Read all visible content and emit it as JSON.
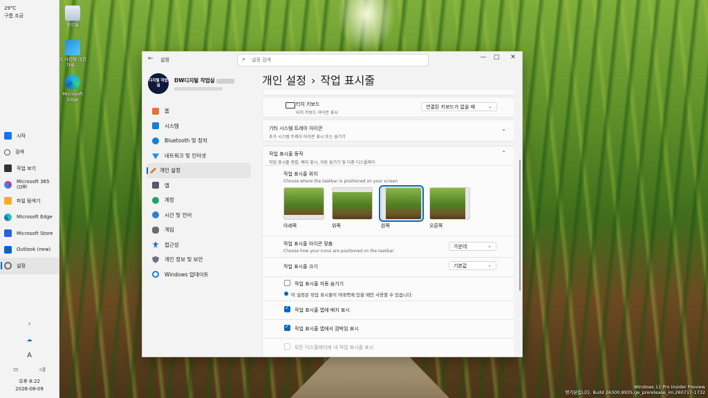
{
  "weather": {
    "temp": "29°C",
    "cond": "구름 조금"
  },
  "desktop_icons": [
    {
      "label": "휴지통"
    },
    {
      "label": "이 사진에 대한 자세..."
    },
    {
      "label": "Microsoft Edge"
    }
  ],
  "taskbar": {
    "items": [
      {
        "label": "시작",
        "color": "#1a73e8"
      },
      {
        "label": "검색",
        "color": "#444444"
      },
      {
        "label": "작업 보기",
        "color": "#333333"
      },
      {
        "label": "Microsoft 365 (Offi",
        "color": "#d03c8c"
      },
      {
        "label": "파일 탐색기",
        "color": "#f2b01e"
      },
      {
        "label": "Microsoft Edge",
        "color": "#0f9bd7"
      },
      {
        "label": "Microsoft Store",
        "color": "#2b62d9"
      },
      {
        "label": "Outlook (new)",
        "color": "#0a64c8"
      },
      {
        "label": "설정",
        "color": "#6b6b6b"
      }
    ],
    "time": "오후 8:22",
    "date": "2026-08-09"
  },
  "window": {
    "app_title": "설정",
    "search_placeholder": "설정 검색",
    "profile": {
      "avatar_text": "디지털 작업실",
      "name": "DW디지털 작업실"
    },
    "nav": [
      {
        "label": "홈",
        "color": "#e5733a"
      },
      {
        "label": "시스템",
        "color": "#1a7fd4"
      },
      {
        "label": "Bluetooth 및 장치",
        "color": "#1a7fd4"
      },
      {
        "label": "네트워크 및 인터넷",
        "color": "#2b8ae0"
      },
      {
        "label": "개인 설정",
        "color": "#d9822b"
      },
      {
        "label": "앱",
        "color": "#555b6e"
      },
      {
        "label": "계정",
        "color": "#21a06a"
      },
      {
        "label": "시간 및 언어",
        "color": "#2f7fd0"
      },
      {
        "label": "게임",
        "color": "#6b6b6b"
      },
      {
        "label": "접근성",
        "color": "#1f6fc4"
      },
      {
        "label": "개인 정보 및 보안",
        "color": "#6b7280"
      },
      {
        "label": "Windows 업데이트",
        "color": "#1a7fd4"
      }
    ],
    "heading_parent": "개인 설정",
    "heading_sep": "›",
    "heading_current": "작업 표시줄",
    "touch_keyboard": {
      "title": "터치 키보드",
      "sub": "터치 키보드 아이콘 표시",
      "value": "연결된 키보드가 없을 때"
    },
    "tray": {
      "title": "기타 시스템 트레이 아이콘",
      "sub": "추가 시스템 트레이 아이콘 표시 또는 숨기기"
    },
    "behaviors": {
      "title": "작업 표시줄 동작",
      "sub": "작업 표시줄 정렬, 배지 표시, 자동 숨기기 및 다중 디스플레이",
      "position_title": "작업 표시줄 위치",
      "position_sub": "Choose where the taskbar is positioned on your screen",
      "positions": [
        "아래쪽",
        "위쪽",
        "왼쪽",
        "오른쪽"
      ],
      "selected_position": "왼쪽",
      "align_title": "작업 표시줄 아이콘 맞춤",
      "align_sub": "Choose how your icons are positioned on the taskbar",
      "align_value": "가운데",
      "size_title": "작업 표시줄 크기",
      "size_value": "기본값",
      "autohide": "작업 표시줄 자동 숨기기",
      "autohide_info": "이 설정은 작업 표시줄이 아래쪽에 있을 때만 사용할 수 있습니다.",
      "badges": "작업 표시줄 앱에 배지 표시",
      "flashing": "작업 표시줄 앱에서 깜박임 표시",
      "multi_display": "모든 디스플레이에 내 작업 표시줄 표시"
    }
  },
  "watermark": {
    "line1": "Windows 11 Pro Insider Preview",
    "line2": "평가본입니다. Build 26300.8935.ge_prerelease_im.260717-1732"
  }
}
